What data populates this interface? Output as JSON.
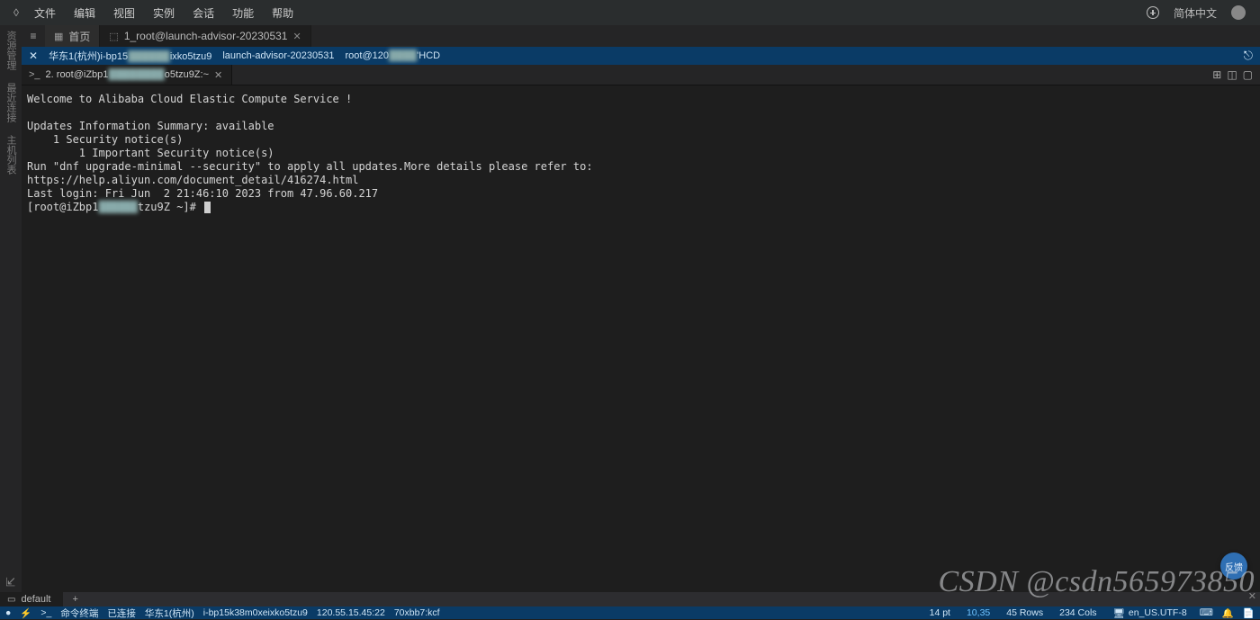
{
  "menu": {
    "items": [
      "文件",
      "编辑",
      "视图",
      "实例",
      "会话",
      "功能",
      "帮助"
    ],
    "lang": "简体中文"
  },
  "tabs": {
    "home": "首页",
    "active": "1_root@launch-advisor-20230531"
  },
  "connbar": {
    "region": "华东1(杭州)i-bp15",
    "instance_suffix": "ixko5tzu9",
    "name": "launch-advisor-20230531",
    "user": "root@120",
    "tc_suffix": "'HCD"
  },
  "session": {
    "label_prefix": "2. root@iZbp1",
    "label_suffix": "o5tzu9Z:~"
  },
  "terminal": {
    "lines": [
      "Welcome to Alibaba Cloud Elastic Compute Service !",
      "",
      "Updates Information Summary: available",
      "    1 Security notice(s)",
      "        1 Important Security notice(s)",
      "Run \"dnf upgrade-minimal --security\" to apply all updates.More details please refer to:",
      "https://help.aliyun.com/document_detail/416274.html",
      "Last login: Fri Jun  2 21:46:10 2023 from 47.96.60.217"
    ],
    "prompt_prefix": "[root@iZbp1",
    "prompt_suffix": "tzu9Z ~]#"
  },
  "bottom_tab": "default",
  "statusbar": {
    "mode": "命令终端",
    "conn": "已连接",
    "region": "华东1(杭州)",
    "instance": "i-bp15k38m0xeixko5tzu9",
    "ip": "120.55.15.45:22",
    "hex": "70xbb7:kcf",
    "pt": "14 pt",
    "pos": "10,35",
    "rows": "45 Rows",
    "cols": "234 Cols",
    "encoding": "en_US.UTF-8"
  },
  "feedback": "反馈",
  "watermark": "CSDN @csdn565973850"
}
